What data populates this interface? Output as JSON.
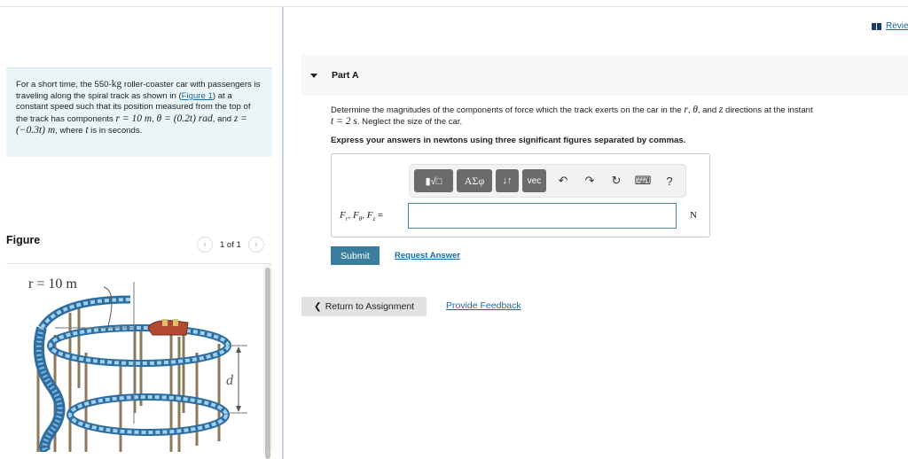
{
  "header": {
    "review_label": "Revie",
    "review_icon": "book-icon"
  },
  "problem": {
    "text_1": "For a short time, the 550-",
    "mass_unit": "kg",
    "text_2": " roller-coaster car with passengers is traveling along the spiral track as shown in (",
    "figure_link": "Figure 1",
    "text_3": ") at a constant speed such that its position measured from the top of the track has components ",
    "r_eq": "r = 10 m",
    "sep_1": ", ",
    "theta_eq": "θ = (0.2t) rad",
    "sep_2": ", and ",
    "z_eq": "z = (−0.3t) m",
    "text_4": ", where ",
    "t_var": "t",
    "text_5": " is in seconds."
  },
  "figure": {
    "title": "Figure",
    "pager_text": "1 of 1",
    "prev_icon": "chevron-left-icon",
    "next_icon": "chevron-right-icon",
    "label_r": "r = 10 m",
    "label_d": "d"
  },
  "part": {
    "title": "Part A",
    "question_1": "Determine the magnitudes of the components of force which the track exerts on the car in the ",
    "var_r": "r",
    "q_sep1": ", ",
    "var_theta": "θ",
    "q_sep2": ", and ",
    "var_z": "z",
    "question_2": " directions at the instant ",
    "t_eq": "t = 2 s",
    "question_3": ". Neglect the size of the car.",
    "instruction": "Express your answers in newtons using three significant figures separated by commas."
  },
  "answer": {
    "toolbar": {
      "templates_label": "▮√□",
      "greek_label": "ΑΣφ",
      "arrows_label": "↓↑",
      "vec_label": "vec",
      "undo_icon": "↶",
      "redo_icon": "↷",
      "reset_icon": "↻",
      "keyboard_icon": "⌨",
      "help_label": "?"
    },
    "label_F": "F",
    "sub_r": "r",
    "sub_theta": "θ",
    "sub_z": "z",
    "comma": ", ",
    "equals": " =",
    "input_value": "",
    "unit": "N"
  },
  "actions": {
    "submit_label": "Submit",
    "request_answer_label": "Request Answer",
    "return_label": "Return to Assignment",
    "feedback_label": "Provide Feedback"
  }
}
